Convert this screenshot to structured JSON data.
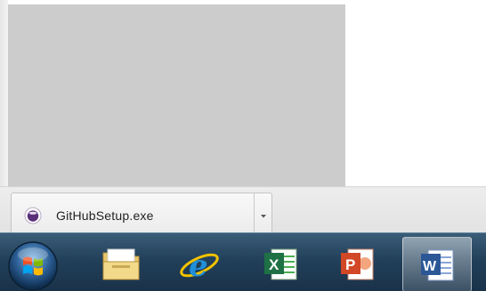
{
  "download_bar": {
    "file_name": "GitHubSetup.exe",
    "file_icon": "github-setup-icon",
    "menu_icon": "chevron-down-icon"
  },
  "taskbar": {
    "start_icon": "windows-start-orb-icon",
    "apps": [
      {
        "icon": "explorer-folder-icon",
        "active": false
      },
      {
        "icon": "internet-explorer-icon",
        "active": false
      },
      {
        "icon": "excel-icon",
        "active": false
      },
      {
        "icon": "powerpoint-icon",
        "active": false
      },
      {
        "icon": "word-icon",
        "active": true
      }
    ]
  },
  "colors": {
    "taskbar": "#22405a",
    "excel": "#1e7145",
    "powerpoint": "#d24726",
    "word": "#2b5797",
    "ie": "#1f8fd8",
    "github_purple": "#6e3b8e"
  }
}
